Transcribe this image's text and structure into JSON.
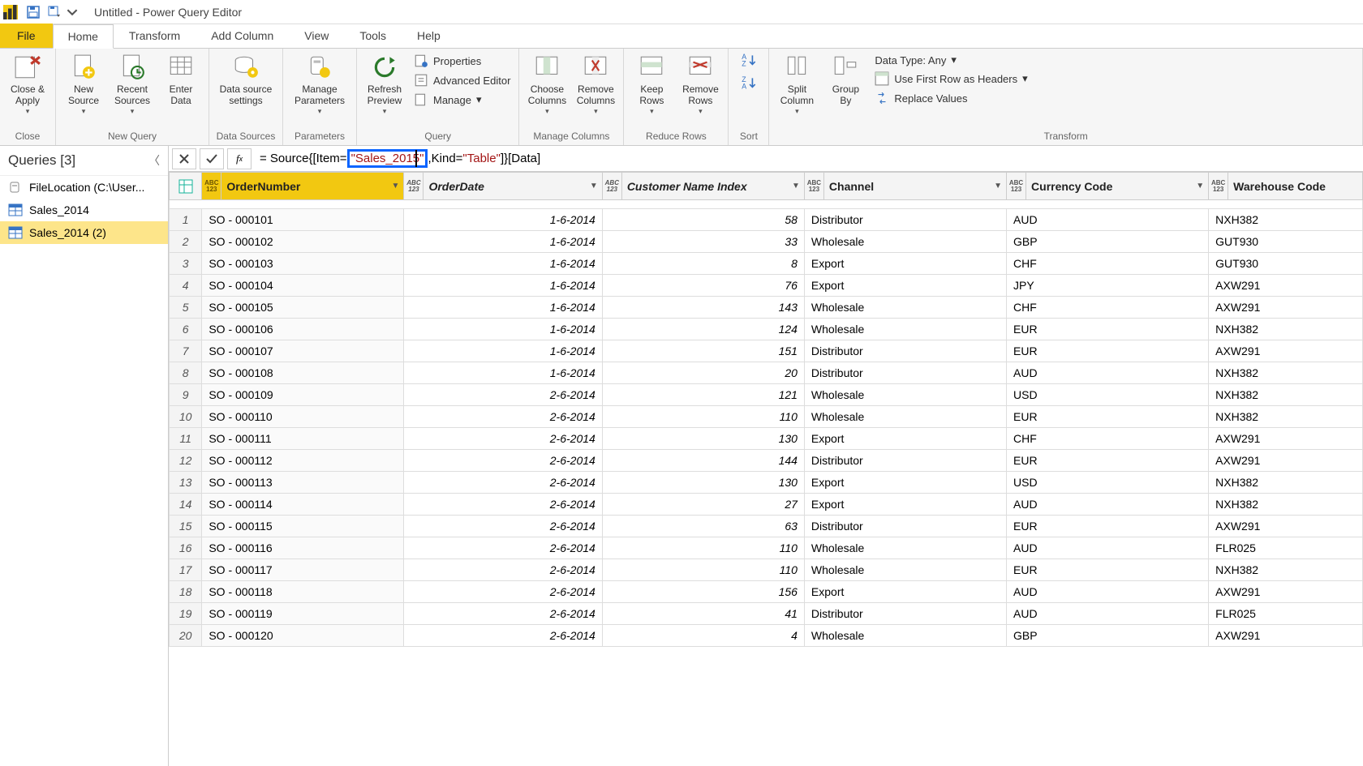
{
  "title": "Untitled - Power Query Editor",
  "menu": {
    "file": "File",
    "home": "Home",
    "transform": "Transform",
    "addcol": "Add Column",
    "view": "View",
    "tools": "Tools",
    "help": "Help"
  },
  "ribbon": {
    "close_apply": "Close &\nApply",
    "close_grp": "Close",
    "new_source": "New\nSource",
    "recent_sources": "Recent\nSources",
    "enter_data": "Enter\nData",
    "newquery_grp": "New Query",
    "data_source": "Data source\nsettings",
    "datasources_grp": "Data Sources",
    "manage_params": "Manage\nParameters",
    "params_grp": "Parameters",
    "refresh": "Refresh\nPreview",
    "properties": "Properties",
    "adv_editor": "Advanced Editor",
    "manage": "Manage",
    "query_grp": "Query",
    "choose_cols": "Choose\nColumns",
    "remove_cols": "Remove\nColumns",
    "mc_grp": "Manage Columns",
    "keep_rows": "Keep\nRows",
    "remove_rows": "Remove\nRows",
    "rr_grp": "Reduce Rows",
    "sort_grp": "Sort",
    "split_col": "Split\nColumn",
    "group_by": "Group\nBy",
    "datatype": "Data Type: Any",
    "first_row": "Use First Row as Headers",
    "replace": "Replace Values",
    "transform_grp": "Transform"
  },
  "queries": {
    "header": "Queries [3]",
    "items": [
      {
        "label": "FileLocation (C:\\User..."
      },
      {
        "label": "Sales_2014"
      },
      {
        "label": "Sales_2014 (2)"
      }
    ]
  },
  "formula": {
    "pre": "= Source{[Item=",
    "highlight": "\"Sales_2015\"",
    "mid": ",Kind=",
    "str2": "\"Table\"",
    "post": "]}[Data]"
  },
  "columns": [
    "OrderNumber",
    "OrderDate",
    "Customer Name Index",
    "Channel",
    "Currency Code",
    "Warehouse Code"
  ],
  "rows": [
    {
      "n": 1,
      "on": "SO - 000101",
      "od": "1-6-2014",
      "ci": "58",
      "ch": "Distributor",
      "cc": "AUD",
      "wc": "NXH382"
    },
    {
      "n": 2,
      "on": "SO - 000102",
      "od": "1-6-2014",
      "ci": "33",
      "ch": "Wholesale",
      "cc": "GBP",
      "wc": "GUT930"
    },
    {
      "n": 3,
      "on": "SO - 000103",
      "od": "1-6-2014",
      "ci": "8",
      "ch": "Export",
      "cc": "CHF",
      "wc": "GUT930"
    },
    {
      "n": 4,
      "on": "SO - 000104",
      "od": "1-6-2014",
      "ci": "76",
      "ch": "Export",
      "cc": "JPY",
      "wc": "AXW291"
    },
    {
      "n": 5,
      "on": "SO - 000105",
      "od": "1-6-2014",
      "ci": "143",
      "ch": "Wholesale",
      "cc": "CHF",
      "wc": "AXW291"
    },
    {
      "n": 6,
      "on": "SO - 000106",
      "od": "1-6-2014",
      "ci": "124",
      "ch": "Wholesale",
      "cc": "EUR",
      "wc": "NXH382"
    },
    {
      "n": 7,
      "on": "SO - 000107",
      "od": "1-6-2014",
      "ci": "151",
      "ch": "Distributor",
      "cc": "EUR",
      "wc": "AXW291"
    },
    {
      "n": 8,
      "on": "SO - 000108",
      "od": "1-6-2014",
      "ci": "20",
      "ch": "Distributor",
      "cc": "AUD",
      "wc": "NXH382"
    },
    {
      "n": 9,
      "on": "SO - 000109",
      "od": "2-6-2014",
      "ci": "121",
      "ch": "Wholesale",
      "cc": "USD",
      "wc": "NXH382"
    },
    {
      "n": 10,
      "on": "SO - 000110",
      "od": "2-6-2014",
      "ci": "110",
      "ch": "Wholesale",
      "cc": "EUR",
      "wc": "NXH382"
    },
    {
      "n": 11,
      "on": "SO - 000111",
      "od": "2-6-2014",
      "ci": "130",
      "ch": "Export",
      "cc": "CHF",
      "wc": "AXW291"
    },
    {
      "n": 12,
      "on": "SO - 000112",
      "od": "2-6-2014",
      "ci": "144",
      "ch": "Distributor",
      "cc": "EUR",
      "wc": "AXW291"
    },
    {
      "n": 13,
      "on": "SO - 000113",
      "od": "2-6-2014",
      "ci": "130",
      "ch": "Export",
      "cc": "USD",
      "wc": "NXH382"
    },
    {
      "n": 14,
      "on": "SO - 000114",
      "od": "2-6-2014",
      "ci": "27",
      "ch": "Export",
      "cc": "AUD",
      "wc": "NXH382"
    },
    {
      "n": 15,
      "on": "SO - 000115",
      "od": "2-6-2014",
      "ci": "63",
      "ch": "Distributor",
      "cc": "EUR",
      "wc": "AXW291"
    },
    {
      "n": 16,
      "on": "SO - 000116",
      "od": "2-6-2014",
      "ci": "110",
      "ch": "Wholesale",
      "cc": "AUD",
      "wc": "FLR025"
    },
    {
      "n": 17,
      "on": "SO - 000117",
      "od": "2-6-2014",
      "ci": "110",
      "ch": "Wholesale",
      "cc": "EUR",
      "wc": "NXH382"
    },
    {
      "n": 18,
      "on": "SO - 000118",
      "od": "2-6-2014",
      "ci": "156",
      "ch": "Export",
      "cc": "AUD",
      "wc": "AXW291"
    },
    {
      "n": 19,
      "on": "SO - 000119",
      "od": "2-6-2014",
      "ci": "41",
      "ch": "Distributor",
      "cc": "AUD",
      "wc": "FLR025"
    },
    {
      "n": 20,
      "on": "SO - 000120",
      "od": "2-6-2014",
      "ci": "4",
      "ch": "Wholesale",
      "cc": "GBP",
      "wc": "AXW291"
    }
  ]
}
